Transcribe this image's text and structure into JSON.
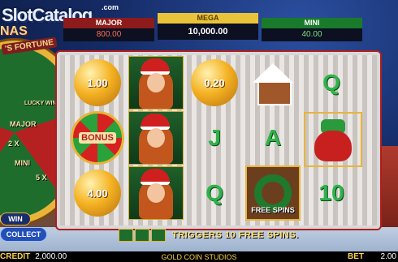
{
  "logo": {
    "text": "SlotCatalog",
    "suffix": ".com",
    "subtitle": "'S FORTUNE",
    "title_fragment": "NAS"
  },
  "jackpots": {
    "major": {
      "label": "MAJOR",
      "value": "800.00"
    },
    "mega": {
      "label": "MEGA",
      "value": "10,000.00"
    },
    "mini": {
      "label": "MINI",
      "value": "40.00"
    }
  },
  "wheel": {
    "labels": [
      "MAJOR",
      "2 X",
      "MINI",
      "5 X",
      "LUCKY WIN"
    ]
  },
  "reels": [
    [
      {
        "type": "coin",
        "value": "1.00"
      },
      {
        "type": "bonus",
        "label": "BONUS"
      },
      {
        "type": "coin",
        "value": "4.00"
      }
    ],
    [
      {
        "type": "santa"
      },
      {
        "type": "santa"
      },
      {
        "type": "santa"
      }
    ],
    [
      {
        "type": "coin",
        "value": "0.20"
      },
      {
        "type": "letter",
        "value": "J"
      },
      {
        "type": "letter",
        "value": "Q"
      }
    ],
    [
      {
        "type": "gingerbread"
      },
      {
        "type": "letter",
        "value": "A"
      },
      {
        "type": "wreath",
        "label": "FREE SPINS"
      }
    ],
    [
      {
        "type": "letter",
        "value": "Q"
      },
      {
        "type": "sack"
      },
      {
        "type": "letter",
        "value": "10"
      }
    ]
  ],
  "buttons": {
    "win": "WIN",
    "collect": "COLLECT"
  },
  "trigger_text": "TRIGGERS 10 FREE SPINS.",
  "status": {
    "credit_label": "CREDIT",
    "credit_value": "2,000.00",
    "studio": "GOLD COIN STUDIOS",
    "bet_label": "BET",
    "bet_value": "2.00"
  },
  "colors": {
    "major": "#8d1b1b",
    "mega": "#e9c43a",
    "mini": "#1a7a2c",
    "coin": "#f5b324",
    "letter": "#2fb24a"
  }
}
